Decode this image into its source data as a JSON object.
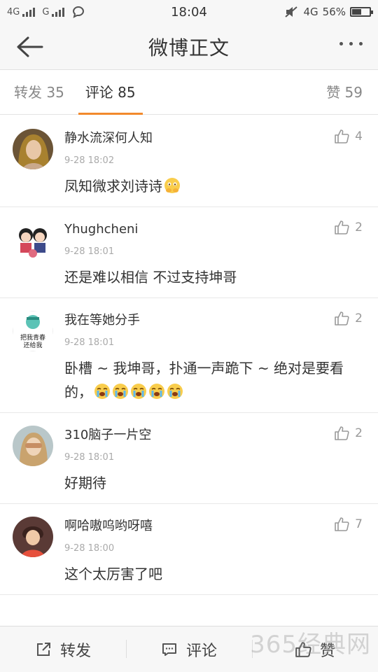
{
  "status_bar": {
    "left": [
      "4G",
      "G"
    ],
    "time": "18:04",
    "network": "4G",
    "battery": "56%",
    "battery_level": 0.56
  },
  "nav": {
    "title": "微博正文"
  },
  "tabs": {
    "repost": "转发 35",
    "comment": "评论 85",
    "like": "赞 59"
  },
  "comments": [
    {
      "user": "静水流深何人知",
      "time": "9-28 18:02",
      "text": "凤知微求刘诗诗",
      "likes": "4",
      "emojis": [
        "praying-face"
      ]
    },
    {
      "user": "Yhughcheni",
      "time": "9-28 18:01",
      "text": "还是难以相信 不过支持坤哥",
      "likes": "2",
      "emojis": []
    },
    {
      "user": "我在等她分手",
      "time": "9-28 18:01",
      "text": "卧槽 ~ 我坤哥，扑通一声跪下 ~ 绝对是要看的，",
      "likes": "2",
      "emojis": [
        "crying-face",
        "crying-face",
        "crying-face",
        "crying-face",
        "crying-face"
      ],
      "avatar_text": [
        "把我青春",
        "还给我"
      ]
    },
    {
      "user": "310脑子一片空",
      "time": "9-28 18:01",
      "text": "好期待",
      "likes": "2",
      "emojis": []
    },
    {
      "user": "啊哈嗷呜哟呀嘻",
      "time": "9-28 18:00",
      "text": "这个太厉害了吧",
      "likes": "7",
      "emojis": []
    }
  ],
  "bottom_bar": {
    "repost": "转发",
    "comment": "评论",
    "like": "赞"
  },
  "watermark": "365经典网",
  "colors": {
    "accent": "#f28a2c",
    "text": "#333333",
    "muted": "#999999"
  }
}
